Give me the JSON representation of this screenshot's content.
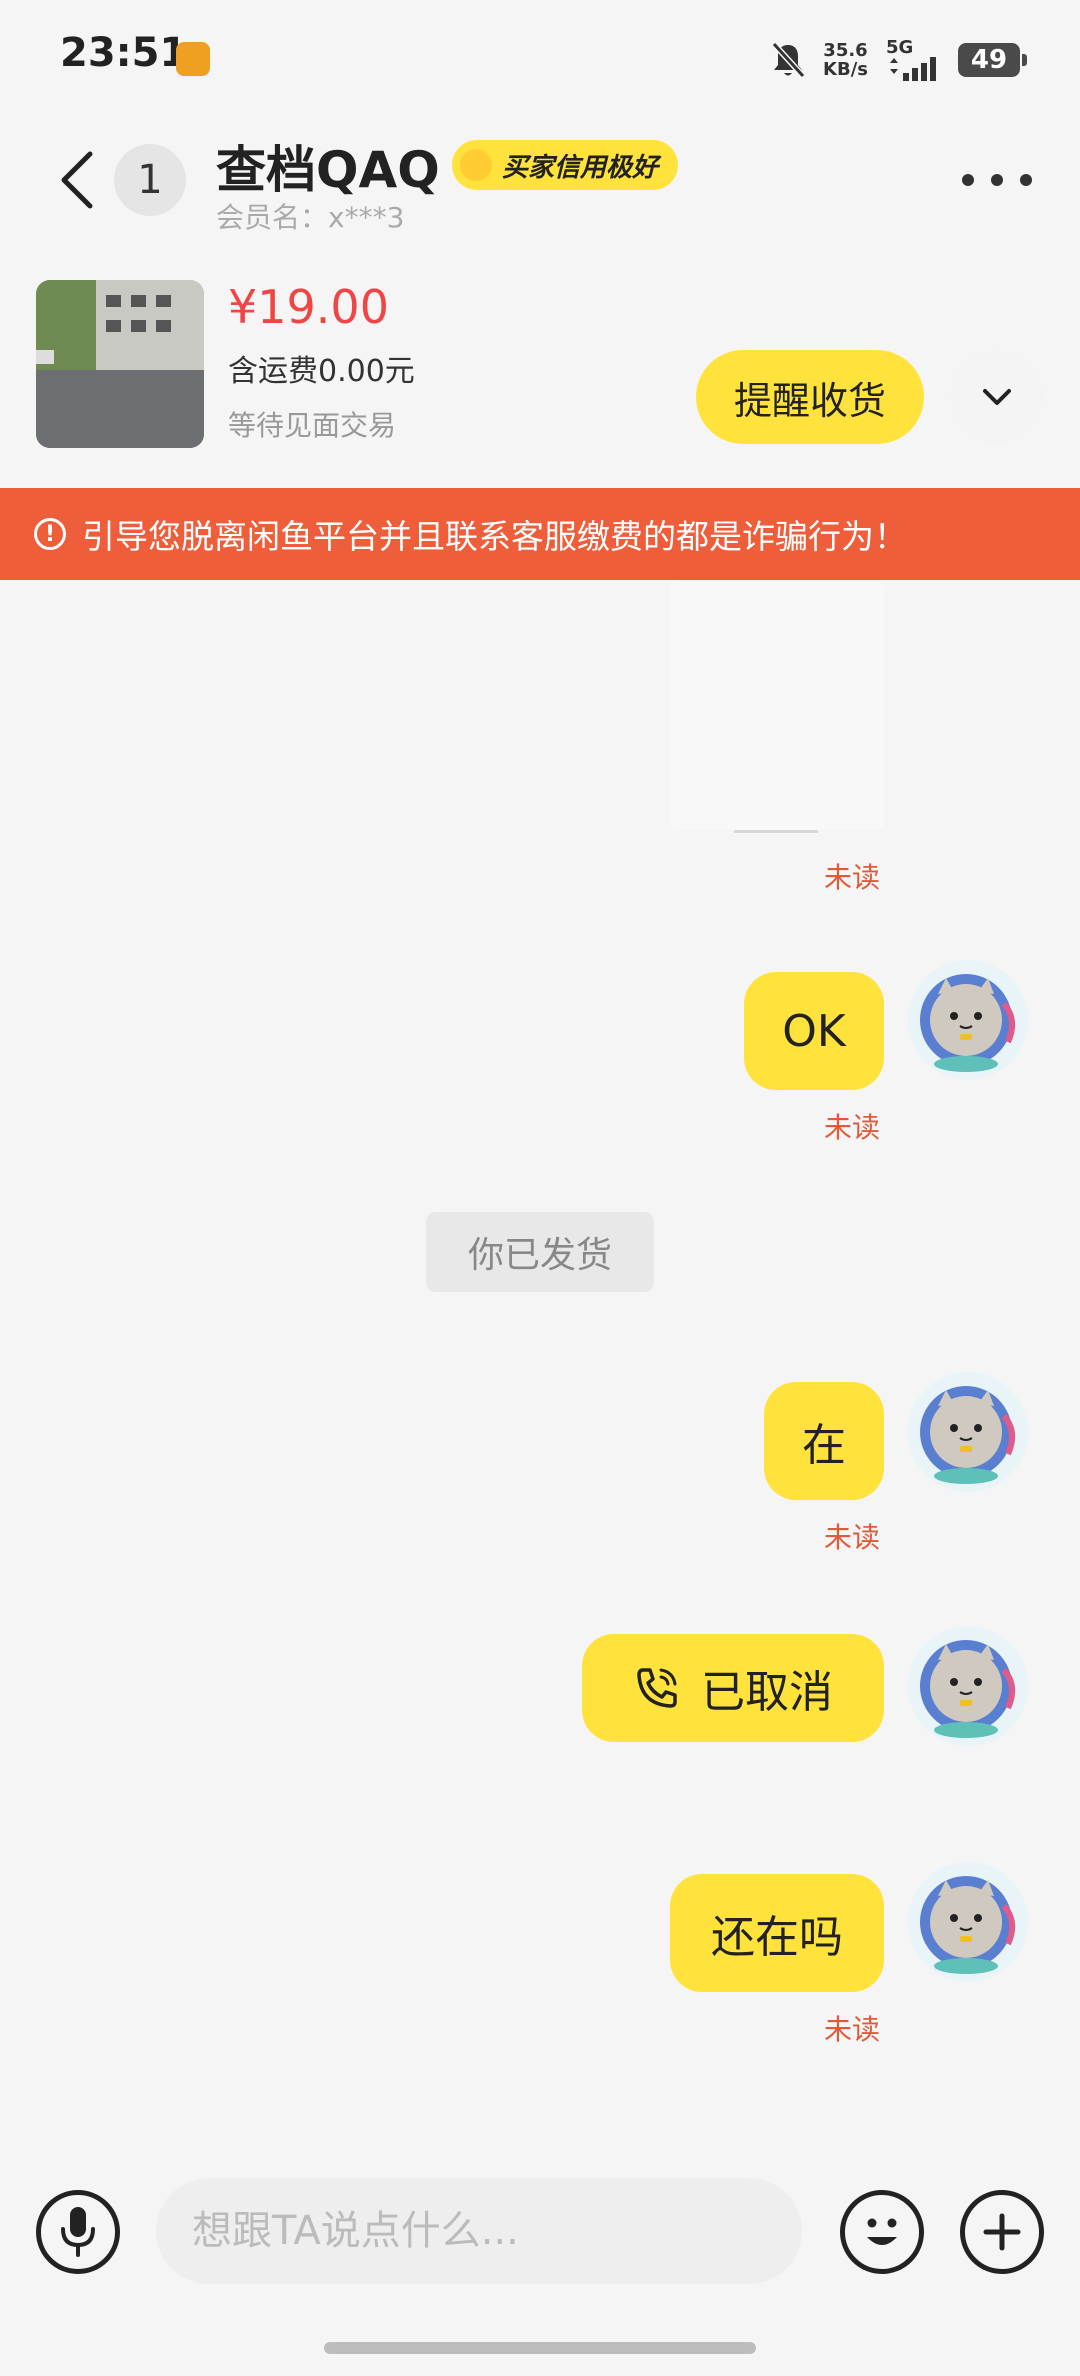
{
  "status_bar": {
    "time": "23:51",
    "net_speed": "35.6",
    "net_unit": "KB/s",
    "network": "5G",
    "battery": "49"
  },
  "header": {
    "back_icon": "chevron-left-icon",
    "unread_count": "1",
    "title": "查档QAQ",
    "credit_badge": "买家信用极好",
    "member_name": "会员名：x***3",
    "more_icon": "more-dots-icon"
  },
  "product": {
    "price": "¥19.00",
    "shipping": "含运费0.00元",
    "trade_status": "等待见面交易",
    "remind_button": "提醒收货",
    "expand_icon": "chevron-down-icon"
  },
  "warning": {
    "text": "引导您脱离闲鱼平台并且联系客服缴费的都是诈骗行为！"
  },
  "messages": [
    {
      "type": "image",
      "status": "未读"
    },
    {
      "type": "text",
      "text": "OK",
      "status": "未读"
    },
    {
      "type": "system",
      "text": "你已发货"
    },
    {
      "type": "text",
      "text": "在",
      "status": "未读"
    },
    {
      "type": "call",
      "text": "已取消"
    },
    {
      "type": "text",
      "text": "还在吗",
      "status": "未读"
    }
  ],
  "input_bar": {
    "placeholder": "想跟TA说点什么...",
    "mic_icon": "microphone-icon",
    "emoji_icon": "emoji-icon",
    "plus_icon": "plus-icon"
  },
  "colors": {
    "accent_yellow": "#ffe33c",
    "price_red": "#f04545",
    "warning_bg": "#ee5e3a",
    "unread_red": "#e05a3a"
  }
}
